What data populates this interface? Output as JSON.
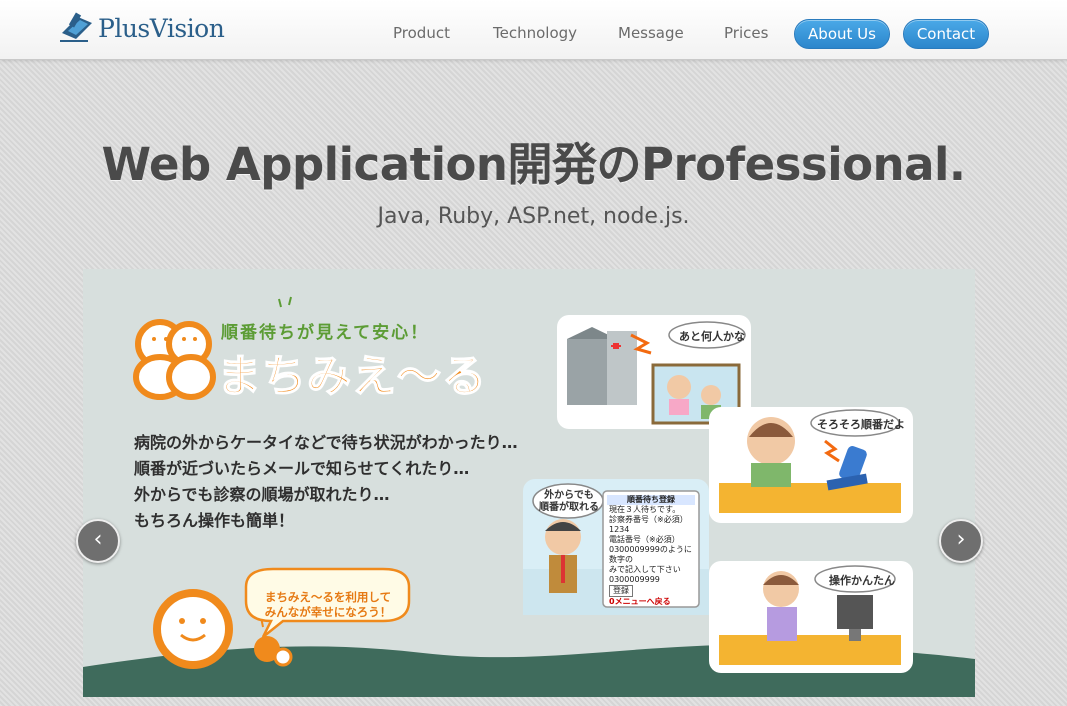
{
  "header": {
    "logo_text": "PlusVision",
    "nav": {
      "product": "Product",
      "technology": "Technology",
      "message": "Message",
      "prices": "Prices",
      "about": "About Us",
      "contact": "Contact"
    }
  },
  "hero": {
    "title": "Web Application開発のProfessional.",
    "subtitle": "Java, Ruby, ASP.net, node.js."
  },
  "slide": {
    "catchphrase": "順番待ちが見えて安心！",
    "brand": "まちみえ〜る",
    "lines": [
      "病院の外からケータイなどで待ち状況がわかったり…",
      "順番が近づいたらメールで知らせてくれたり…",
      "外からでも診察の順場が取れたり…",
      "もちろん操作も簡単！"
    ],
    "mascot_bubble": [
      "まちみえ〜るを利用して",
      "みんなが幸せになろう！"
    ],
    "scenes": {
      "hospital_bubble": "あと何人かな",
      "phone_bubble": "そろそろ順番だよ",
      "outside_bubble": [
        "外からでも",
        "順番が取れる"
      ],
      "pc_bubble": "操作かんたん"
    },
    "phone_screen": {
      "title": "順番待ち登録",
      "line1": "現在３人待ちです。",
      "line2": "診察券番号（※必須）",
      "line3": "1234",
      "line4": "電話番号（※必須）",
      "line5": "0300009999のように数字の",
      "line6": "みで記入して下さい",
      "line7": "0300009999",
      "button": "登録",
      "menu": "0メニューへ戻る"
    },
    "prev_icon": "chevron-left-icon",
    "next_icon": "chevron-right-icon",
    "prev_symbol": "‹",
    "next_symbol": "›"
  },
  "colors": {
    "accent_blue": "#2c86cc",
    "brand_orange": "#f08a1c",
    "catch_green": "#5c9c35",
    "ground": "#3f6b5c"
  }
}
